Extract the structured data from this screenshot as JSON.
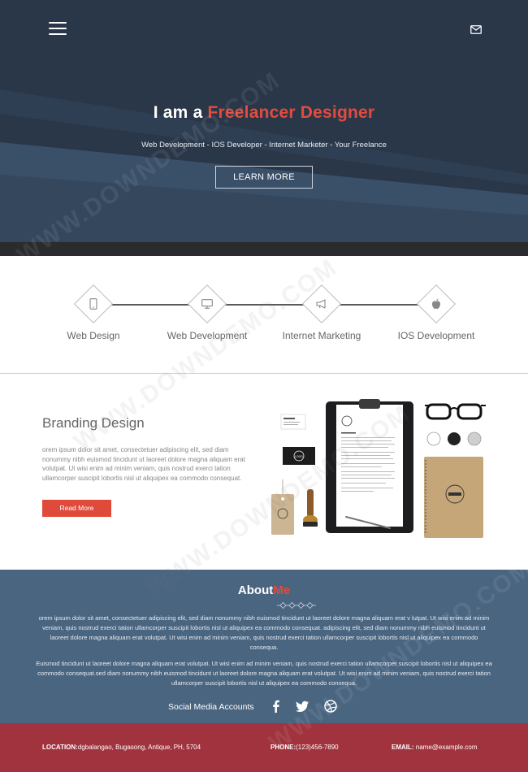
{
  "header": {
    "title_prefix": "I am a ",
    "title_accent": "Freelancer Designer",
    "subtitle": "Web Development - IOS Developer - Internet Marketer - Your Freelance",
    "cta_label": "LEARN MORE"
  },
  "services": [
    {
      "label": "Web Design",
      "icon": "mobile-icon"
    },
    {
      "label": "Web Development",
      "icon": "monitor-icon"
    },
    {
      "label": "Internet Marketing",
      "icon": "megaphone-icon"
    },
    {
      "label": "IOS Development",
      "icon": "apple-icon"
    }
  ],
  "branding": {
    "title": "Branding Design",
    "text": "orem ipsum dolor sit amet, consectetuer adipiscing elit, sed diam nonummy nibh euismod tincidunt ut laoreet dolore magna aliquam erat volutpat. Ut wisi enim ad minim veniam, quis nostrud exerci tation ullamcorper suscipit lobortis nisl ut aliquipex ea commodo consequat.",
    "button": "Read More"
  },
  "about": {
    "title_prefix": "About",
    "title_accent": "Me",
    "p1": "orem ipsum dolor sit amet, consectetuer adipiscing elit, sed diam nonummy nibh euismod tincidunt ut laoreet dolore magna aliquam erat v lutpat. Ut wisi enim ad minim veniam, quis nostrud exerci tation ullamcorper suscipit lobortis nisl ut aliquipex ea commodo consequat. adipiscing elit, sed diam nonummy nibh euismod tincidunt ut laoreet dolore magna aliquam erat volutpat. Ut wisi enim ad minim veniam, quis nostrud exerci tation ullamcorper suscipit lobortis nisl ut aliquipex ea commodo consequa.",
    "p2": "Euismod tincidunt ut laoreet dolore magna aliquam erat volutpat. Ut wisi enim ad minim veniam, quis nostrud exerci tation ullamcorper suscipit lobortis nisl ut aliquipex ea commodo consequat.sed diam nonummy nibh euismod tincidunt ut laoreet dolore magna aliquam erat volutpat. Ut wisi enim ad minim veniam, quis nostrud exerci tation ullamcorper suscipit lobortis nisl ut aliquipex ea commodo consequa.",
    "social_label": "Social Media Accounts",
    "social_icons": [
      "facebook-icon",
      "twitter-icon",
      "dribbble-icon"
    ]
  },
  "footer": {
    "location_label": "LOCATION:",
    "location_value": "dgbalangao, Bugasong, Antique, PH, 5704",
    "phone_label": "PHONE:",
    "phone_value": "(123)456-7890",
    "email_label": "EMAIL:",
    "email_value": " name@example.com"
  },
  "mockup": {
    "logo_text": "LOGO"
  },
  "watermark": "WWW.DOWNDEMO.COM",
  "colors": {
    "accent": "#e44b3c",
    "hero_bg": "#2a3749",
    "about_bg": "#4a6580",
    "footer_bg": "#a0333d"
  }
}
